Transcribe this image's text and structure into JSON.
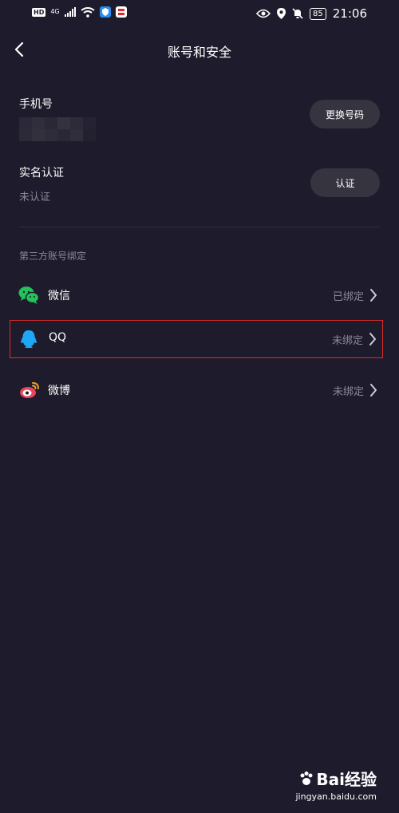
{
  "status_bar": {
    "left_badges": [
      "HD",
      "4G"
    ],
    "battery": "85",
    "time": "21:06"
  },
  "header": {
    "title": "账号和安全",
    "back_icon": "chevron-left-icon"
  },
  "phone": {
    "label": "手机号",
    "button": "更换号码"
  },
  "real_name": {
    "label": "实名认证",
    "status": "未认证",
    "button": "认证"
  },
  "third_party": {
    "section_title": "第三方账号绑定",
    "items": [
      {
        "name": "微信",
        "status": "已绑定",
        "icon": "wechat-icon",
        "color": "#22c35a"
      },
      {
        "name": "QQ",
        "status": "未绑定",
        "icon": "qq-icon",
        "color": "#1ea7f4"
      },
      {
        "name": "微博",
        "status": "未绑定",
        "icon": "weibo-icon",
        "color": "#e8455a"
      }
    ]
  },
  "colors": {
    "background": "#1e1c2c",
    "button_bg": "#36343f",
    "muted_text": "#8b8997",
    "highlight_border": "#e02a2a"
  },
  "watermark": {
    "logo": "Bai经验",
    "url": "jingyan.baidu.com"
  }
}
